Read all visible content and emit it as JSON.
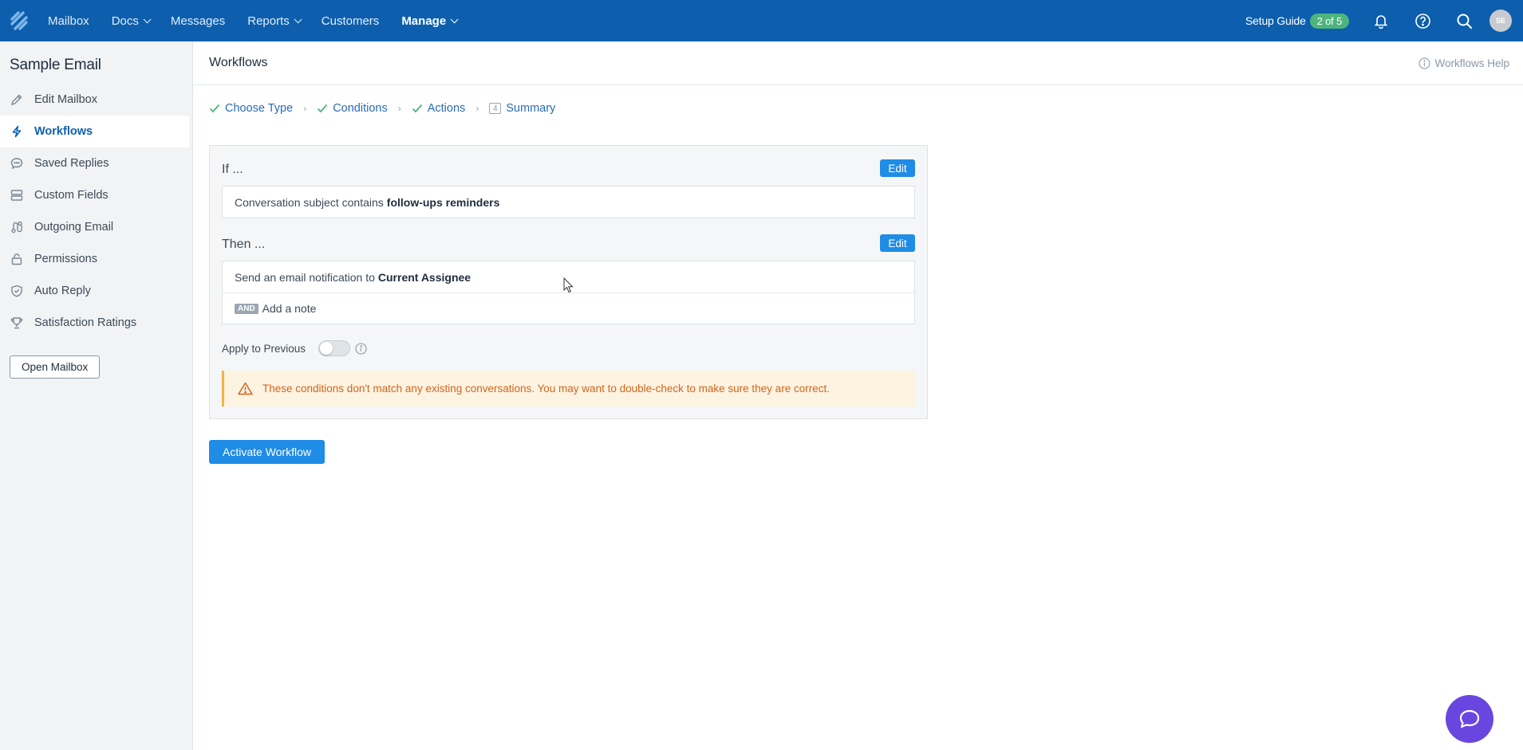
{
  "topnav": {
    "items": [
      {
        "label": "Mailbox",
        "has_caret": false
      },
      {
        "label": "Docs",
        "has_caret": true
      },
      {
        "label": "Messages",
        "has_caret": false
      },
      {
        "label": "Reports",
        "has_caret": true
      },
      {
        "label": "Customers",
        "has_caret": false
      },
      {
        "label": "Manage",
        "has_caret": true
      }
    ],
    "setup_label": "Setup Guide",
    "setup_progress": "2 of 5",
    "avatar_initials": "SE",
    "color": "#0d5fad"
  },
  "sidebar": {
    "title": "Sample Email",
    "items": [
      {
        "label": "Edit Mailbox",
        "icon": "pencil-icon"
      },
      {
        "label": "Workflows",
        "icon": "lightning-icon",
        "active": true
      },
      {
        "label": "Saved Replies",
        "icon": "chat-bubble-icon"
      },
      {
        "label": "Custom Fields",
        "icon": "fields-icon"
      },
      {
        "label": "Outgoing Email",
        "icon": "route-icon"
      },
      {
        "label": "Permissions",
        "icon": "lock-icon"
      },
      {
        "label": "Auto Reply",
        "icon": "shield-check-icon"
      },
      {
        "label": "Satisfaction Ratings",
        "icon": "trophy-icon"
      }
    ],
    "open_mailbox": "Open Mailbox"
  },
  "header": {
    "title": "Workflows",
    "help": "Workflows Help"
  },
  "steps": [
    {
      "label": "Choose Type",
      "done": true
    },
    {
      "label": "Conditions",
      "done": true
    },
    {
      "label": "Actions",
      "done": true
    },
    {
      "label": "Summary",
      "done": false,
      "number": "4"
    }
  ],
  "card": {
    "if_label": "If ...",
    "then_label": "Then ...",
    "edit_label": "Edit",
    "condition_text": "Conversation subject contains",
    "condition_value": "follow-ups reminders",
    "action_text": "Send an email notification to",
    "action_value": "Current Assignee",
    "and_tag": "AND",
    "action2_text": "Add a note",
    "apply_label": "Apply to Previous",
    "warning": "These conditions don't match any existing conversations. You may want to double-check to make sure they are correct."
  },
  "activate_label": "Activate Workflow",
  "colors": {
    "accent": "#1f8ce6",
    "beacon": "#6a46e0",
    "success": "#4eb47d",
    "warning_text": "#d1651c"
  }
}
